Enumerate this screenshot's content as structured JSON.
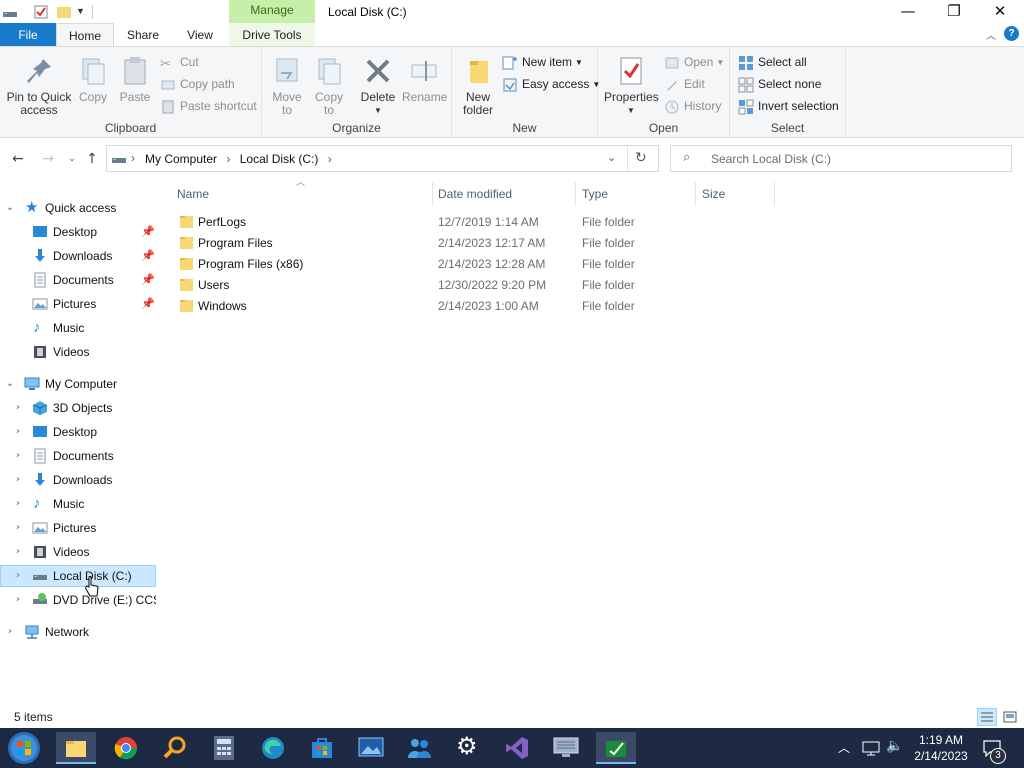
{
  "window": {
    "title": "Local Disk (C:)",
    "context_tab_group": "Manage",
    "controls": {
      "minimize": "—",
      "restore": "❐",
      "close": "✕"
    }
  },
  "ribbon": {
    "tabs": {
      "file": "File",
      "home": "Home",
      "share": "Share",
      "view": "View",
      "drive_tools": "Drive Tools"
    },
    "clipboard": {
      "label": "Clipboard",
      "pin_to_quick_access": "Pin to Quick access",
      "copy": "Copy",
      "paste": "Paste",
      "cut": "Cut",
      "copy_path": "Copy path",
      "paste_shortcut": "Paste shortcut"
    },
    "organize": {
      "label": "Organize",
      "move_to": "Move to",
      "copy_to": "Copy to",
      "delete": "Delete",
      "rename": "Rename"
    },
    "new": {
      "label": "New",
      "new_folder": "New folder",
      "new_item": "New item",
      "easy_access": "Easy access"
    },
    "open": {
      "label": "Open",
      "properties": "Properties",
      "open": "Open",
      "edit": "Edit",
      "history": "History"
    },
    "select": {
      "label": "Select",
      "select_all": "Select all",
      "select_none": "Select none",
      "invert_selection": "Invert selection"
    }
  },
  "address": {
    "crumb_root": "My Computer",
    "crumb_current": "Local Disk (C:)",
    "separator": "›",
    "search_placeholder": "Search Local Disk (C:)"
  },
  "nav_pane": {
    "quick_access": "Quick access",
    "quick_items": [
      "Desktop",
      "Downloads",
      "Documents",
      "Pictures",
      "Music",
      "Videos"
    ],
    "my_computer": "My Computer",
    "computer_items": [
      "3D Objects",
      "Desktop",
      "Documents",
      "Downloads",
      "Music",
      "Pictures",
      "Videos",
      "Local Disk (C:)",
      "DVD Drive (E:) CCSA"
    ],
    "network": "Network"
  },
  "columns": {
    "name": "Name",
    "date_modified": "Date modified",
    "type": "Type",
    "size": "Size"
  },
  "files": [
    {
      "name": "PerfLogs",
      "date": "12/7/2019 1:14 AM",
      "type": "File folder"
    },
    {
      "name": "Program Files",
      "date": "2/14/2023 12:17 AM",
      "type": "File folder"
    },
    {
      "name": "Program Files (x86)",
      "date": "2/14/2023 12:28 AM",
      "type": "File folder"
    },
    {
      "name": "Users",
      "date": "12/30/2022 9:20 PM",
      "type": "File folder"
    },
    {
      "name": "Windows",
      "date": "2/14/2023 1:00 AM",
      "type": "File folder"
    }
  ],
  "status": {
    "item_count": "5 items"
  },
  "taskbar": {
    "time": "1:19 AM",
    "date": "2/14/2023",
    "notification_count": "3",
    "icons": [
      "start-orb-icon",
      "file-explorer-icon",
      "chrome-icon",
      "search-magnifier-icon",
      "calculator-icon",
      "edge-icon",
      "store-icon",
      "screen-capture-icon",
      "people-icon",
      "settings-gear-icon",
      "visual-studio-icon",
      "remote-desktop-icon",
      "terminal-app-icon"
    ]
  },
  "colors": {
    "file_tab": "#1979ca",
    "manage_tab": "#c6efa9",
    "selection": "#cce8ff",
    "taskbar": "#1e2a44",
    "folder": "#f8d775"
  }
}
